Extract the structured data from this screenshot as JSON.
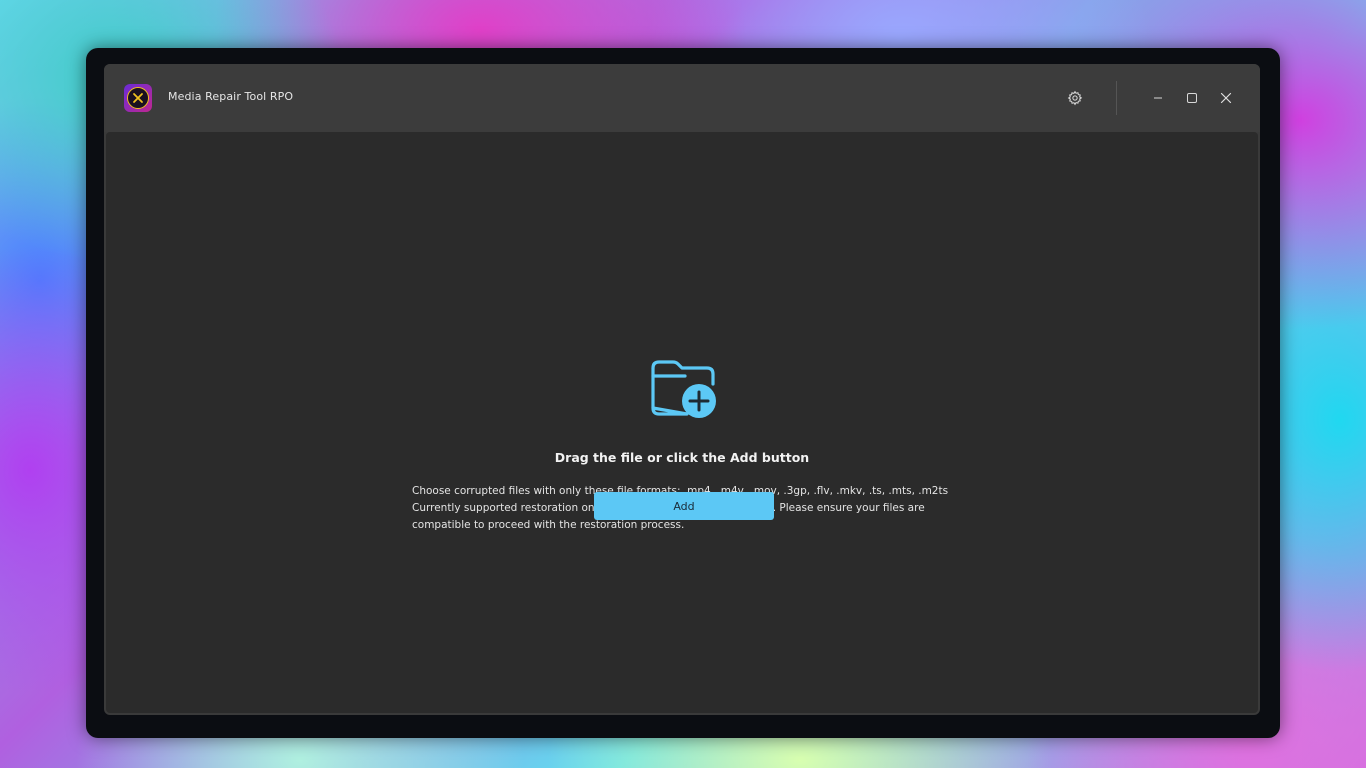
{
  "window": {
    "title": "Media Repair Tool RPO",
    "controls": {
      "settings": "gear-icon",
      "minimize": "minimize-icon",
      "maximize": "maximize-icon",
      "close": "close-icon"
    }
  },
  "dropzone": {
    "icon": "folder-add-icon",
    "title": "Drag the file or click the Add button",
    "description_lines": [
      "Choose corrupted files with only these file formats: .mp4, .m4v, .mov, .3gp, .flv, .mkv, .ts, .mts, .m2ts",
      "Currently supported restoration only for video files with H.264 codec. Please ensure your files are",
      "compatible to proceed with the restoration process."
    ],
    "add_label": "Add"
  },
  "colors": {
    "accent": "#5cc8f5",
    "content_bg": "#2b2b2b",
    "titlebar_bg": "#3c3c3c"
  }
}
